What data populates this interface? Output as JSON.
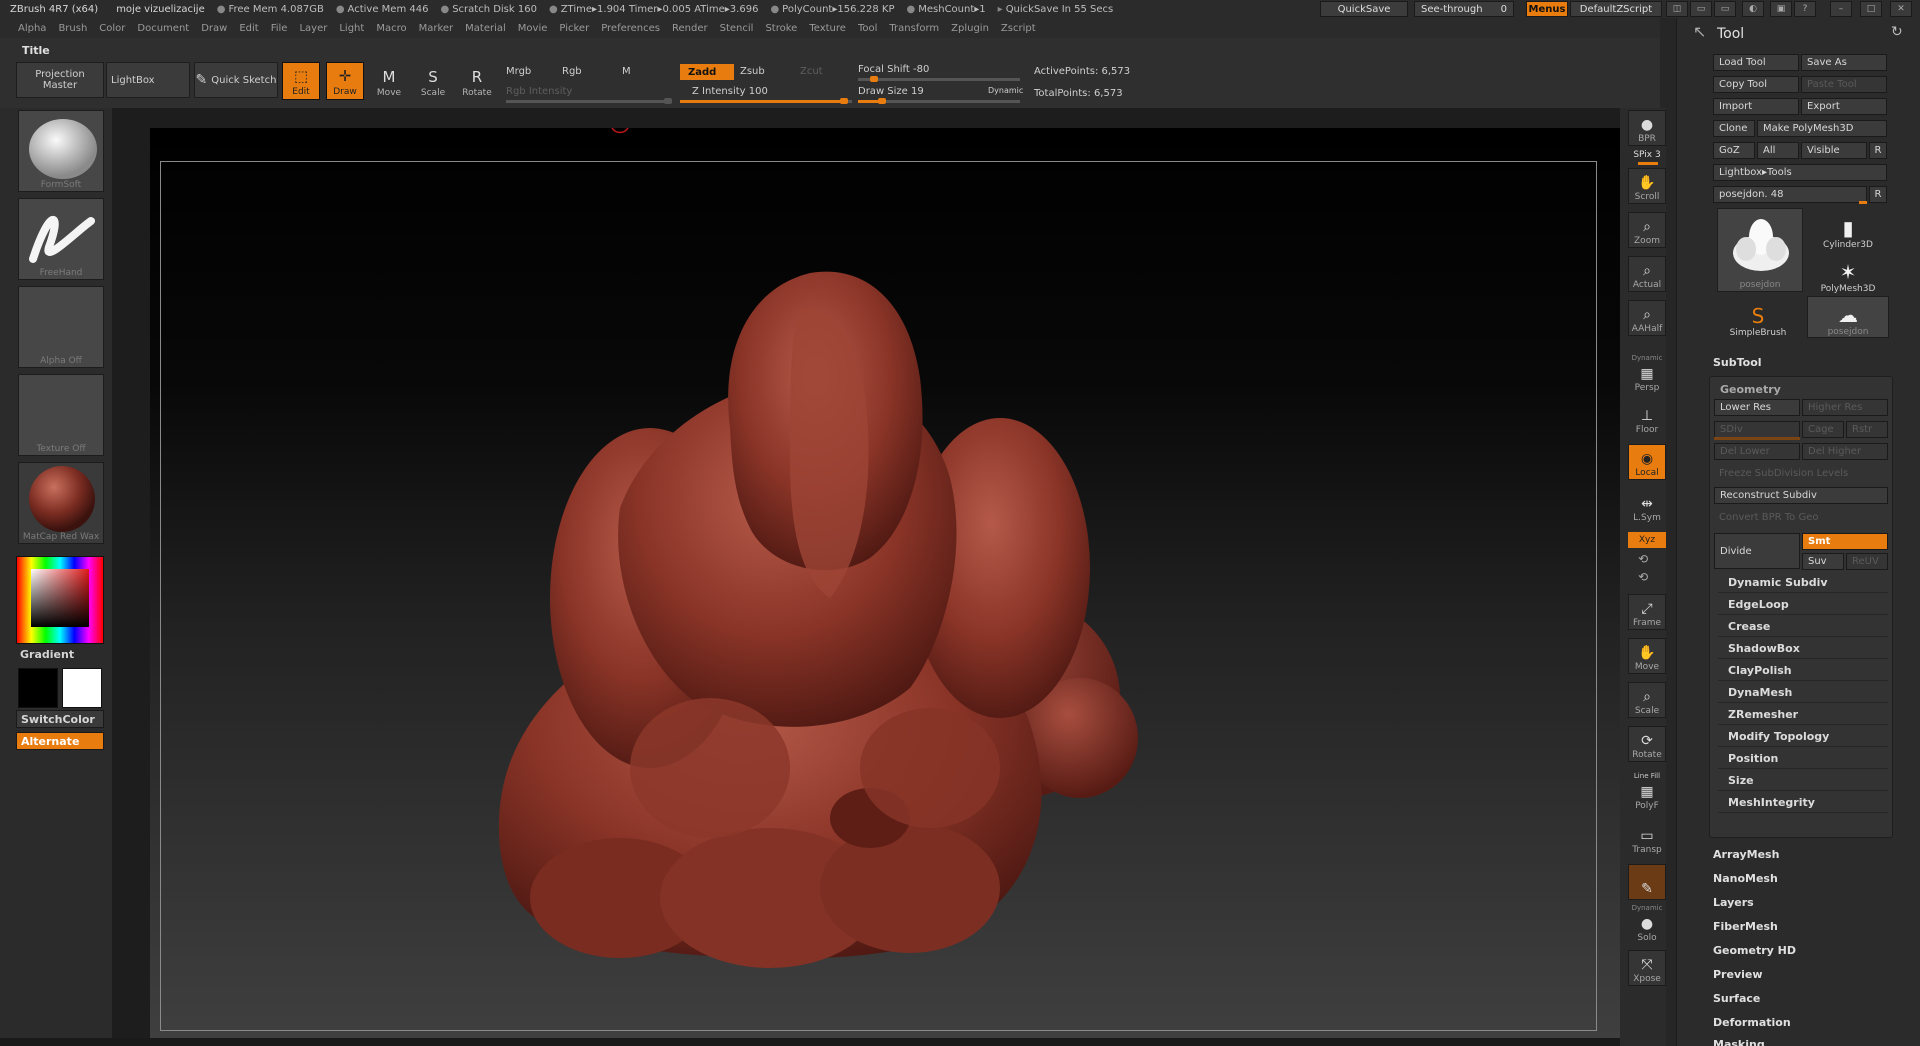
{
  "titlebar": {
    "app": "ZBrush 4R7 (x64)",
    "doc": "moje vizuelizacije",
    "stats": [
      "Free Mem 4.087GB",
      "Active Mem 446",
      "Scratch Disk 160",
      "ZTime▸1.904 Timer▸0.005 ATime▸3.696",
      "PolyCount▸156.228 KP",
      "MeshCount▸1"
    ],
    "quicksave_timer": "QuickSave In 55 Secs",
    "quicksave_btn": "QuickSave",
    "seethrough_label": "See-through",
    "seethrough_value": "0",
    "menus_btn": "Menus",
    "script_btn": "DefaultZScript"
  },
  "menubar": [
    "Alpha",
    "Brush",
    "Color",
    "Document",
    "Draw",
    "Edit",
    "File",
    "Layer",
    "Light",
    "Macro",
    "Marker",
    "Material",
    "Movie",
    "Picker",
    "Preferences",
    "Render",
    "Stencil",
    "Stroke",
    "Texture",
    "Tool",
    "Transform",
    "Zplugin",
    "Zscript"
  ],
  "toolbar": {
    "title": "Title",
    "projection_master": "Projection Master",
    "lightbox": "LightBox",
    "quick_sketch": "Quick Sketch",
    "edit": "Edit",
    "draw": "Draw",
    "move": "Move",
    "scale": "Scale",
    "rotate": "Rotate",
    "mrgb": "Mrgb",
    "rgb": "Rgb",
    "m": "M",
    "rgb_intensity": "Rgb Intensity",
    "zadd": "Zadd",
    "zsub": "Zsub",
    "zcut": "Zcut",
    "z_intensity": "Z Intensity 100",
    "focal_shift": "Focal Shift -80",
    "draw_size": "Draw Size 19",
    "dynamic": "Dynamic",
    "active_points": "ActivePoints: 6,573",
    "total_points": "TotalPoints: 6,573"
  },
  "leftpal": {
    "brush": "FormSoft",
    "stroke": "FreeHand",
    "alpha": "Alpha Off",
    "texture": "Texture Off",
    "material": "MatCap Red Wax",
    "gradient": "Gradient",
    "switchcolor": "SwitchColor",
    "alternate": "Alternate"
  },
  "rightshelf": [
    {
      "label": "BPR",
      "name": "bpr-button"
    },
    {
      "label": "SPix 3",
      "name": "spix-slider"
    },
    {
      "label": "Scroll",
      "name": "scroll-button"
    },
    {
      "label": "Zoom",
      "name": "zoom-button"
    },
    {
      "label": "Actual",
      "name": "actual-button"
    },
    {
      "label": "AAHalf",
      "name": "aahalf-button"
    },
    {
      "label": "Persp",
      "name": "persp-button"
    },
    {
      "label": "Floor",
      "name": "floor-button"
    },
    {
      "label": "Local",
      "name": "local-button"
    },
    {
      "label": "L.Sym",
      "name": "lsym-button"
    },
    {
      "label": "Xyz",
      "name": "xyz-button"
    },
    {
      "label": "Frame",
      "name": "frame-button"
    },
    {
      "label": "Move",
      "name": "move-view-button"
    },
    {
      "label": "Scale",
      "name": "scale-view-button"
    },
    {
      "label": "Rotate",
      "name": "rotate-view-button"
    },
    {
      "label": "PolyF",
      "name": "polyf-button"
    },
    {
      "label": "Transp",
      "name": "transp-button"
    },
    {
      "label": "Solo",
      "name": "solo-button"
    },
    {
      "label": "Xpose",
      "name": "xpose-button"
    }
  ],
  "rightshelf_extra": {
    "dynamic": "Dynamic",
    "line_fill": "Line Fill"
  },
  "toolpanel": {
    "title": "Tool",
    "load_tool": "Load Tool",
    "save_as": "Save As",
    "copy_tool": "Copy Tool",
    "paste_tool": "Paste Tool",
    "import": "Import",
    "export": "Export",
    "clone": "Clone",
    "make_polymesh": "Make PolyMesh3D",
    "goz": "GoZ",
    "all": "All",
    "visible": "Visible",
    "r": "R",
    "lightbox_tools": "Lightbox▸Tools",
    "current_tool": "posejdon. 48",
    "tiles": [
      {
        "name": "posejdon",
        "big": true
      },
      {
        "name": "Cylinder3D"
      },
      {
        "name": "PolyMesh3D"
      },
      {
        "name": "SimpleBrush"
      },
      {
        "name": "posejdon"
      }
    ],
    "subtool": "SubTool",
    "geometry": "Geometry",
    "lower_res": "Lower Res",
    "higher_res": "Higher Res",
    "sdiv": "SDiv",
    "cage": "Cage",
    "rstr": "Rstr",
    "del_lower": "Del Lower",
    "del_higher": "Del Higher",
    "freeze_subdiv": "Freeze SubDivision Levels",
    "reconstruct_subdiv": "Reconstruct Subdiv",
    "convert_bpr": "Convert BPR To Geo",
    "divide": "Divide",
    "smt": "Smt",
    "suv": "Suv",
    "reuv": "ReUV",
    "geometry_items": [
      "Dynamic Subdiv",
      "EdgeLoop",
      "Crease",
      "ShadowBox",
      "ClayPolish",
      "DynaMesh",
      "ZRemesher",
      "Modify Topology",
      "Position",
      "Size",
      "MeshIntegrity"
    ],
    "sections": [
      "ArrayMesh",
      "NanoMesh",
      "Layers",
      "FiberMesh",
      "Geometry HD",
      "Preview",
      "Surface",
      "Deformation",
      "Masking"
    ]
  },
  "colors": {
    "accent": "#e87c0e",
    "model": "#8f3a2e",
    "panel": "#2b2b2b"
  }
}
